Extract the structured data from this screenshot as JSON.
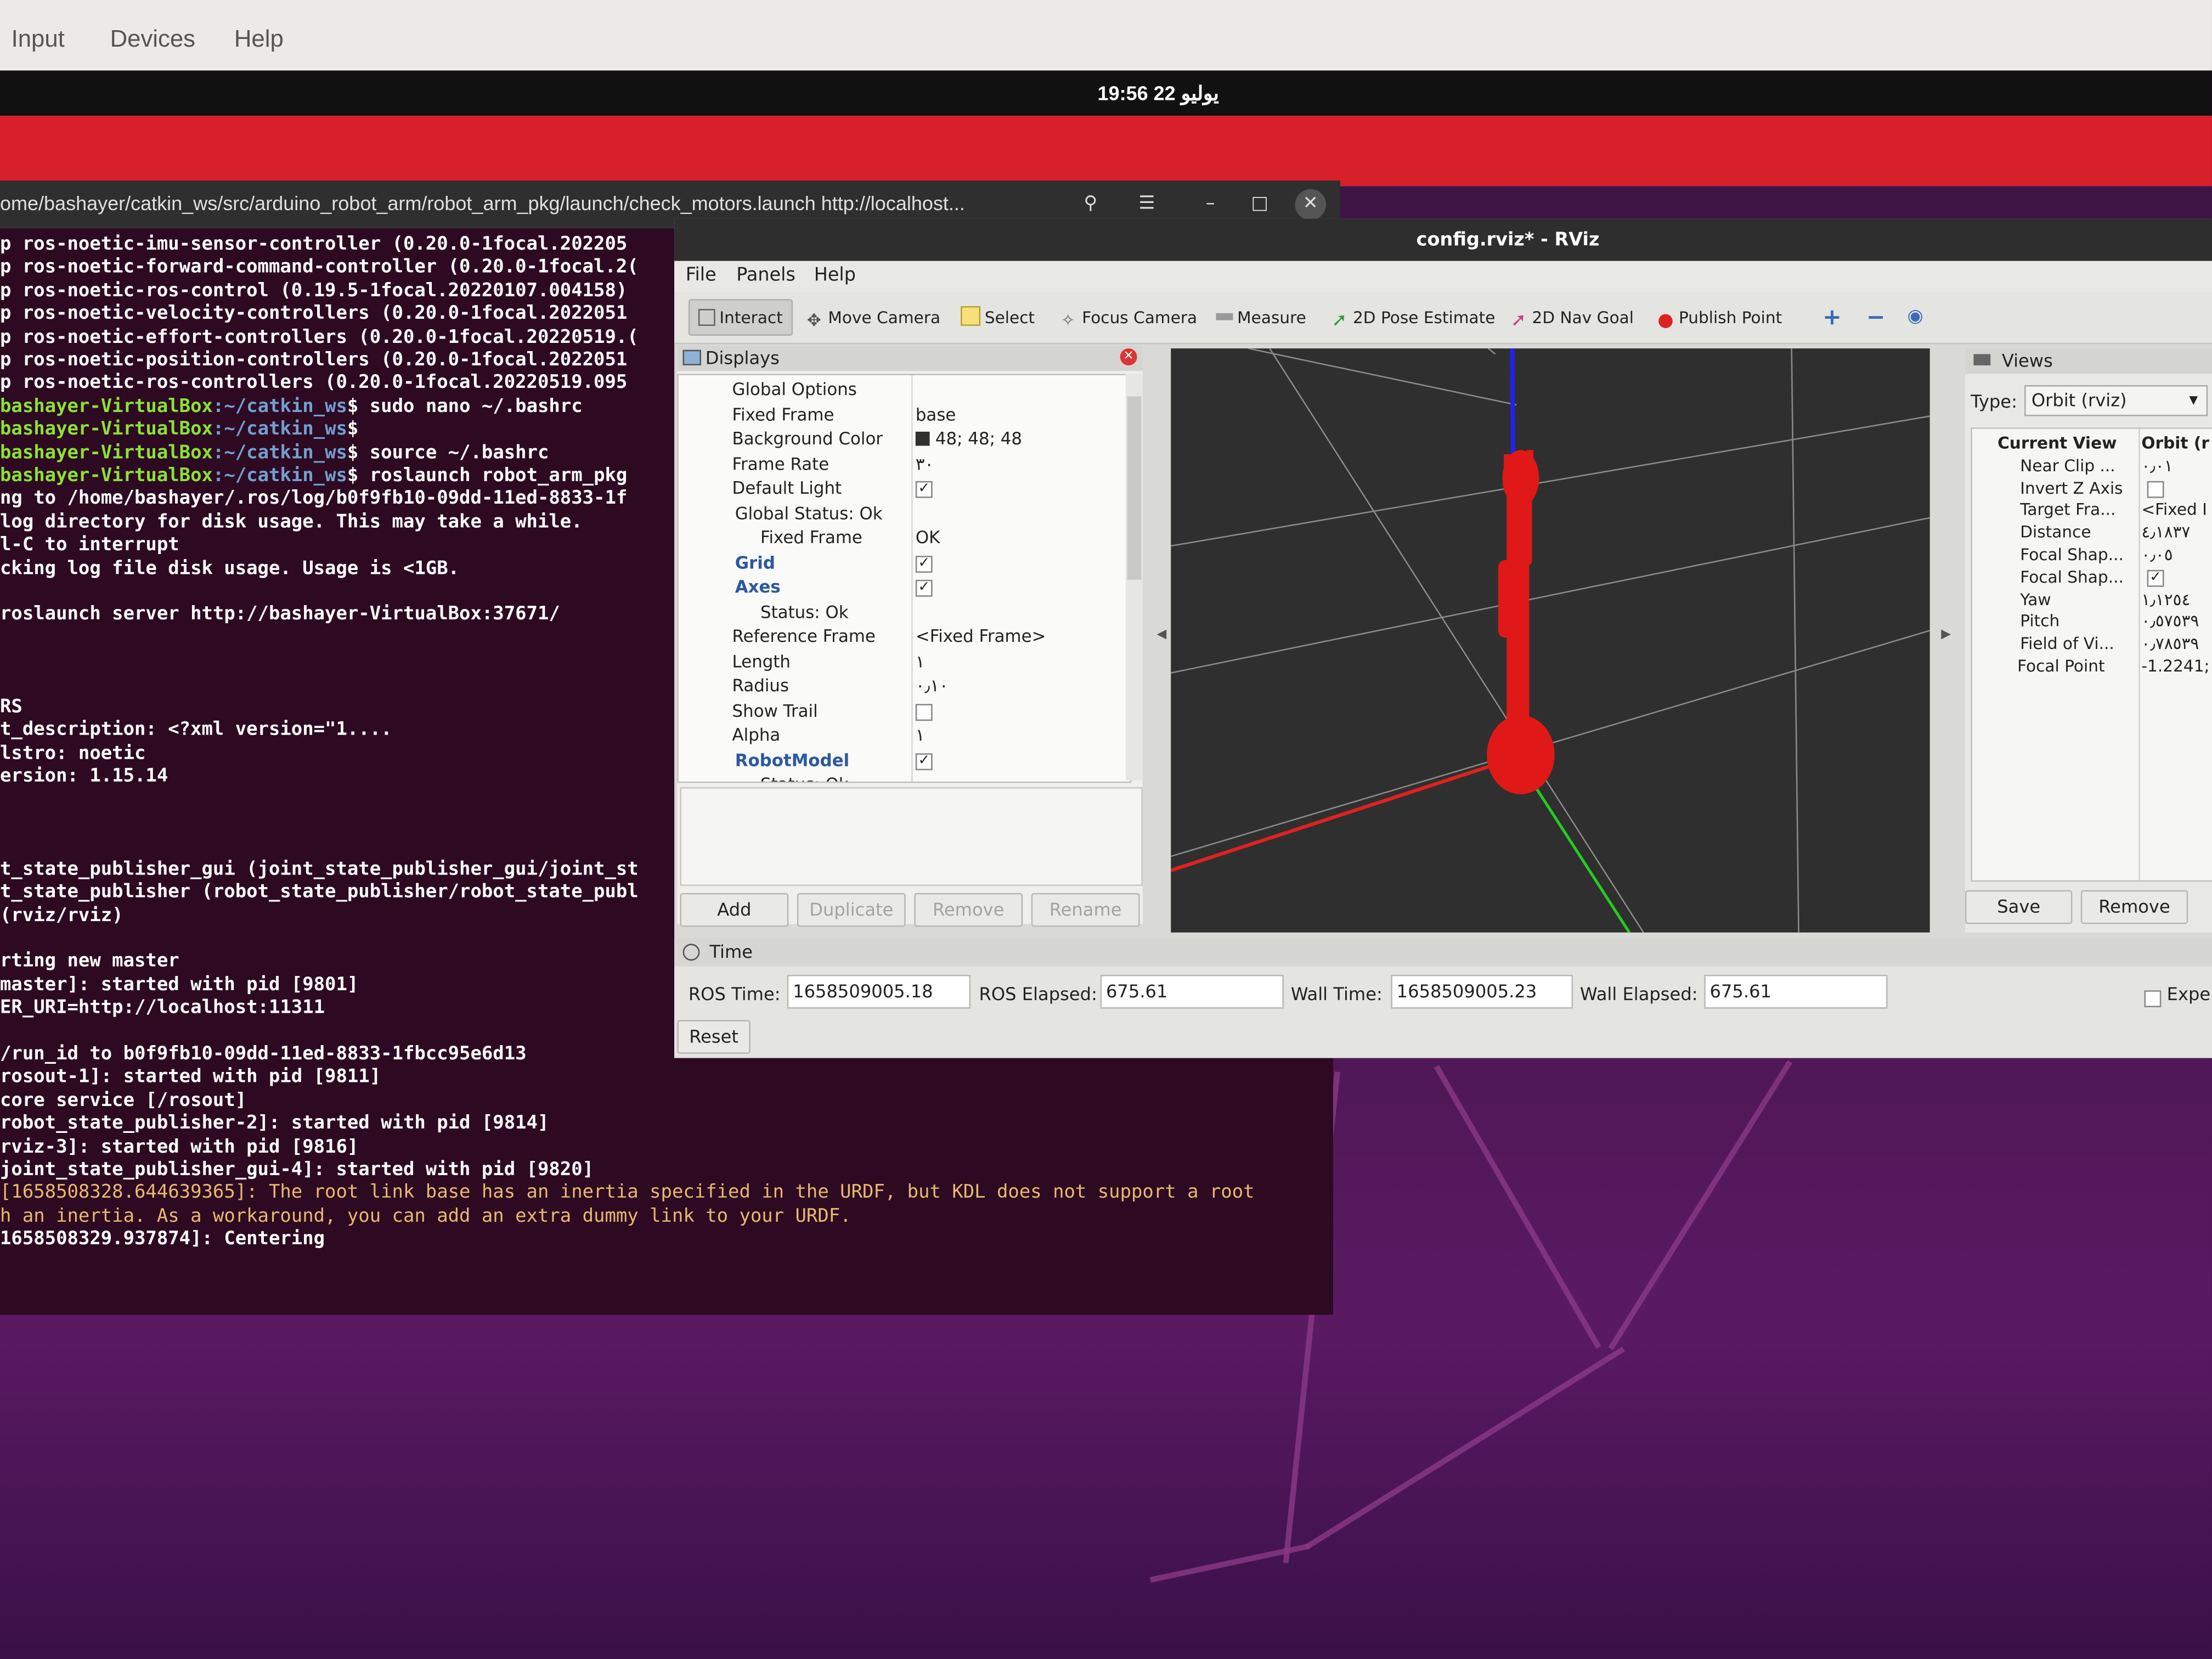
{
  "host_menu": {
    "items": [
      "Input",
      "Devices",
      "Help"
    ]
  },
  "top_bar": {
    "clock": "19:56 22 يوليو"
  },
  "terminal": {
    "title": "ome/bashayer/catkin_ws/src/arduino_robot_arm/robot_arm_pkg/launch/check_motors.launch http://localhost...",
    "lines": [
      {
        "text": "p ros-noetic-imu-sensor-controller (0.20.0-1focal.202205"
      },
      {
        "text": "p ros-noetic-forward-command-controller (0.20.0-1focal.2("
      },
      {
        "text": "p ros-noetic-ros-control (0.19.5-1focal.20220107.004158)"
      },
      {
        "text": "p ros-noetic-velocity-controllers (0.20.0-1focal.2022051"
      },
      {
        "text": "p ros-noetic-effort-controllers (0.20.0-1focal.20220519.("
      },
      {
        "text": "p ros-noetic-position-controllers (0.20.0-1focal.2022051"
      },
      {
        "text": "p ros-noetic-ros-controllers (0.20.0-1focal.20220519.095"
      },
      {
        "prompt_user": "bashayer-VirtualBox",
        "prompt_path": ":~/catkin_ws",
        "cmd": "$ sudo nano ~/.bashrc"
      },
      {
        "prompt_user": "bashayer-VirtualBox",
        "prompt_path": ":~/catkin_ws",
        "cmd": "$"
      },
      {
        "prompt_user": "bashayer-VirtualBox",
        "prompt_path": ":~/catkin_ws",
        "cmd": "$ source ~/.bashrc"
      },
      {
        "prompt_user": "bashayer-VirtualBox",
        "prompt_path": ":~/catkin_ws",
        "cmd": "$ roslaunch robot_arm_pkg"
      },
      {
        "text": "ng to /home/bashayer/.ros/log/b0f9fb10-09dd-11ed-8833-1f"
      },
      {
        "text": " log directory for disk usage. This may take a while."
      },
      {
        "text": "l-C to interrupt"
      },
      {
        "text": "cking log file disk usage. Usage is <1GB."
      },
      {
        "text": ""
      },
      {
        "text": "roslaunch server http://bashayer-VirtualBox:37671/"
      },
      {
        "text": ""
      },
      {
        "text": ""
      },
      {
        "text": ""
      },
      {
        "text": "RS"
      },
      {
        "text": "t_description: <?xml version=\"1...."
      },
      {
        "text": "lstro: noetic"
      },
      {
        "text": "ersion: 1.15.14"
      },
      {
        "text": ""
      },
      {
        "text": ""
      },
      {
        "text": ""
      },
      {
        "text": "t_state_publisher_gui (joint_state_publisher_gui/joint_st"
      },
      {
        "text": "t_state_publisher (robot_state_publisher/robot_state_publ"
      },
      {
        "text": " (rviz/rviz)"
      },
      {
        "text": ""
      },
      {
        "text": "rting new master"
      },
      {
        "text": "master]: started with pid [9801]"
      },
      {
        "text": "ER_URI=http://localhost:11311"
      },
      {
        "text": ""
      },
      {
        "text": "/run_id to b0f9fb10-09dd-11ed-8833-1fbcc95e6d13"
      },
      {
        "text": "rosout-1]: started with pid [9811]"
      },
      {
        "text": "core service [/rosout]"
      },
      {
        "text": "robot_state_publisher-2]: started with pid [9814]"
      },
      {
        "text": "rviz-3]: started with pid [9816]"
      },
      {
        "text": "joint_state_publisher_gui-4]: started with pid [9820]"
      },
      {
        "text": "[1658508328.644639365]: The root link base has an inertia specified in the URDF, but KDL does not support a root",
        "warn": true
      },
      {
        "text": "h an inertia.  As a workaround, you can add an extra dummy link to your URDF.",
        "warn": true
      },
      {
        "text": "1658508329.937874]: Centering"
      }
    ]
  },
  "rviz": {
    "title": "config.rviz* - RViz",
    "menu": [
      "File",
      "Panels",
      "Help"
    ],
    "tools": [
      "Interact",
      "Move Camera",
      "Select",
      "Focus Camera",
      "Measure",
      "2D Pose Estimate",
      "2D Nav Goal",
      "Publish Point"
    ],
    "displays": {
      "title": "Displays",
      "rows": [
        {
          "key": "Global Options",
          "value": ""
        },
        {
          "key": "Fixed Frame",
          "value": "base"
        },
        {
          "key": "Background Color",
          "value": "48; 48; 48"
        },
        {
          "key": "Frame Rate",
          "value": "٣٠"
        },
        {
          "key": "Default Light",
          "value": "✓"
        },
        {
          "key": "Global Status: Ok",
          "value": ""
        },
        {
          "key": "Fixed Frame",
          "value": "OK"
        },
        {
          "key": "Grid",
          "value": "✓"
        },
        {
          "key": "Axes",
          "value": "✓"
        },
        {
          "key": "Status: Ok",
          "value": ""
        },
        {
          "key": "Reference Frame",
          "value": "<Fixed Frame>"
        },
        {
          "key": "Length",
          "value": "١"
        },
        {
          "key": "Radius",
          "value": "٠٫١٠"
        },
        {
          "key": "Show Trail",
          "value": ""
        },
        {
          "key": "Alpha",
          "value": "١"
        },
        {
          "key": "RobotModel",
          "value": "✓"
        },
        {
          "key": "Status: Ok",
          "value": ""
        }
      ],
      "buttons": [
        "Add",
        "Duplicate",
        "Remove",
        "Rename"
      ]
    },
    "views": {
      "title": "Views",
      "type_label": "Type:",
      "type_value": "Orbit (rviz)",
      "rows": [
        {
          "key": "Current View",
          "value": "Orbit (r"
        },
        {
          "key": "Near Clip ...",
          "value": "٠٫٠١"
        },
        {
          "key": "Invert Z Axis",
          "value": ""
        },
        {
          "key": "Target Fra...",
          "value": "<Fixed I"
        },
        {
          "key": "Distance",
          "value": "٤٫١٨٣٧"
        },
        {
          "key": "Focal Shap...",
          "value": "٠٫٠٥"
        },
        {
          "key": "Focal Shap...",
          "value": "✓"
        },
        {
          "key": "Yaw",
          "value": "١٫١٢٥٤"
        },
        {
          "key": "Pitch",
          "value": "٠٫٥٧٥٣٩"
        },
        {
          "key": "Field of Vi...",
          "value": "٠٫٧٨٥٣٩"
        },
        {
          "key": "Focal Point",
          "value": "-1.2241;"
        }
      ],
      "buttons": [
        "Save",
        "Remove"
      ]
    },
    "time": {
      "title": "Time",
      "ros_time_label": "ROS Time:",
      "ros_time": "1658509005.18",
      "ros_elapsed_label": "ROS Elapsed:",
      "ros_elapsed": "675.61",
      "wall_time_label": "Wall Time:",
      "wall_time": "1658509005.23",
      "wall_elapsed_label": "Wall Elapsed:",
      "wall_elapsed": "675.61",
      "experimental": "Exper",
      "reset": "Reset"
    }
  },
  "colors": {
    "terminal_bg": "#2d0a22",
    "rviz_bg": "#2f2f2f",
    "robot": "#e01818",
    "accent_red": "#d8202a"
  }
}
